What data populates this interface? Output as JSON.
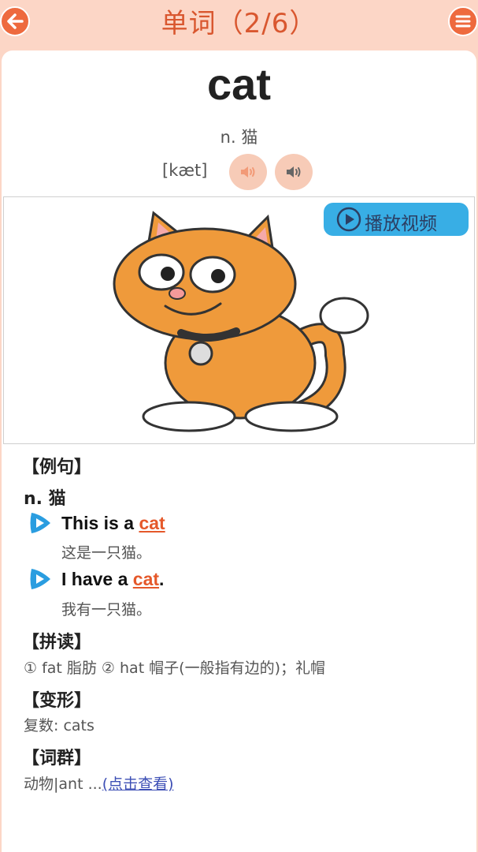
{
  "header": {
    "title": "单词（2/6）"
  },
  "word": {
    "text": "cat",
    "meaning": "n. 猫",
    "phonetic": "[kæt]"
  },
  "video_button": {
    "label": "播放视频"
  },
  "sections": {
    "examples_label": "【例句】",
    "examples_pos": "n. 猫",
    "sentences": [
      {
        "before": "This is a ",
        "keyword": "cat",
        "after": "",
        "translation": "这是一只猫。"
      },
      {
        "before": "I have a ",
        "keyword": "cat",
        "after": ".",
        "translation": "我有一只猫。"
      }
    ],
    "phonics_label": "【拼读】",
    "phonics_text": "① fat 脂肪 ② hat 帽子(一般指有边的)；礼帽",
    "forms_label": "【变形】",
    "forms_text": "复数: cats",
    "group_label": "【词群】",
    "group_text": "动物|ant ...",
    "group_link": "(点击查看)"
  },
  "colors": {
    "accent": "#ee6a3e",
    "header_bg": "#fcd6c6",
    "keyword": "#e5582a",
    "video_button": "#38aee5"
  }
}
